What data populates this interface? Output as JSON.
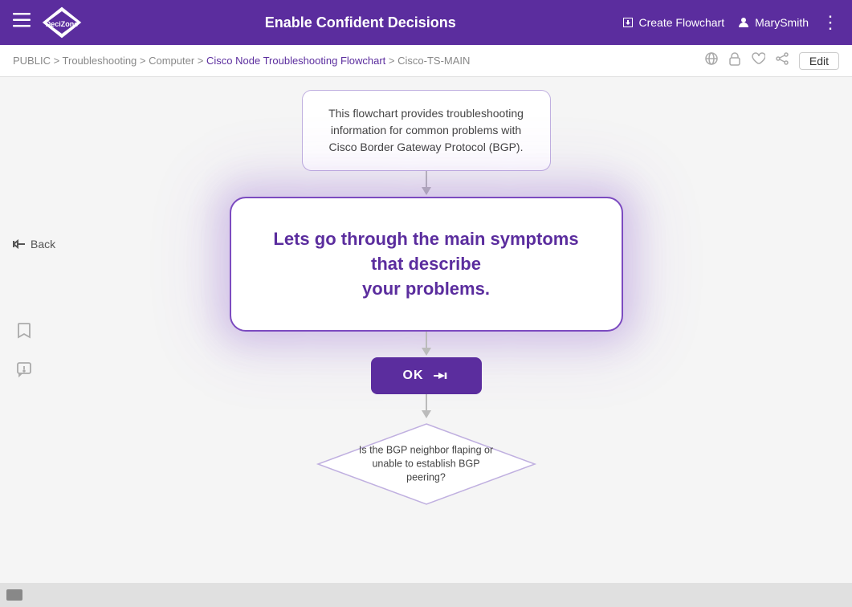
{
  "header": {
    "menu_label": "☰",
    "logo_text": "DeciZone",
    "title": "Enable Confident Decisions",
    "create_flowchart_label": "Create Flowchart",
    "user_label": "MarySmith",
    "more_icon": "⋮"
  },
  "breadcrumb": {
    "path": "PUBLIC > Troubleshooting > Computer >",
    "active": "Cisco Node Troubleshooting Flowchart",
    "suffix": "> Cisco-TS-MAIN"
  },
  "breadcrumb_actions": {
    "globe_icon": "🌐",
    "lock_icon": "🔒",
    "heart_icon": "♡",
    "person_icon": "👤",
    "edit_label": "Edit"
  },
  "side_panel": {
    "bookmark_icon": "bookmark",
    "alert_icon": "alert"
  },
  "back_button": {
    "label": "Back"
  },
  "flowchart": {
    "info_box_text": "This flowchart provides troubleshooting information for common problems with Cisco Border Gateway Protocol (BGP).",
    "main_box_line1": "Lets go through the main symptoms that describe",
    "main_box_line2": "your problems.",
    "ok_button_label": "OK",
    "diamond_label": "Is the BGP neighbor flaping or unable to establish BGP peering?"
  },
  "colors": {
    "purple": "#5b2d9e",
    "light_purple_border": "#c0b0e0",
    "connector": "#bbbbbb"
  }
}
